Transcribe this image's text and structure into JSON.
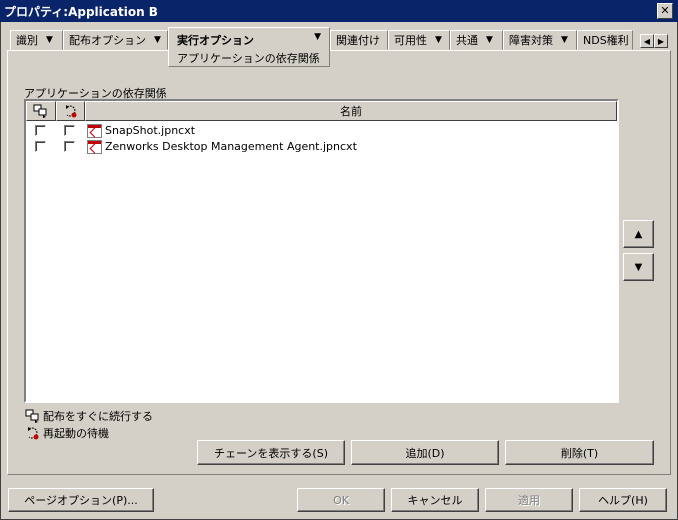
{
  "window": {
    "title": "プロパティ:Application B",
    "close_glyph": "✕"
  },
  "tabs": [
    {
      "label": "識別"
    },
    {
      "label": "配布オプション"
    },
    {
      "label": "実行オプション",
      "sub_label": "アプリケーションの依存関係"
    },
    {
      "label": "関連付け"
    },
    {
      "label": "可用性"
    },
    {
      "label": "共通"
    },
    {
      "label": "障害対策"
    },
    {
      "label": "NDS権利"
    }
  ],
  "dropdown_glyph": "▼",
  "tab_scroll": {
    "left": "◀",
    "right": "▶"
  },
  "dependencies": {
    "group_label": "アプリケーションの依存関係",
    "columns": {
      "name": "名前"
    },
    "items": [
      {
        "name": "SnapShot.jpncxt",
        "continue_checked": false,
        "reboot_checked": false
      },
      {
        "name": "Zenworks Desktop Management Agent.jpncxt",
        "continue_checked": false,
        "reboot_checked": false
      }
    ]
  },
  "move": {
    "up": "▲",
    "down": "▼"
  },
  "legend": {
    "continue": "配布をすぐに続行する",
    "reboot": "再起動の待機"
  },
  "actions": {
    "show_chain": "チェーンを表示する(S)",
    "add": "追加(D)",
    "delete": "削除(T)"
  },
  "footer": {
    "page_options": "ページオプション(P)...",
    "ok": "OK",
    "cancel": "キャンセル",
    "apply": "適用",
    "help": "ヘルプ(H)"
  }
}
